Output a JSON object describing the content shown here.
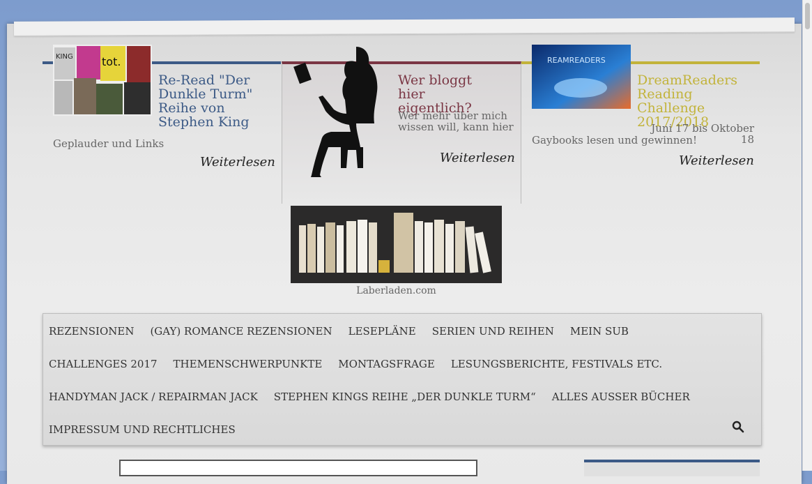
{
  "features": [
    {
      "title": "Re-Read \"Der Dunkle Turm\" Reihe von Stephen King",
      "desc": "Geplauder und Links",
      "more": "Weiterlesen",
      "color": "#3c5a86"
    },
    {
      "title": "Wer bloggt hier eigentlich?",
      "desc": "Wer mehr über mich wissen will, kann hier",
      "more": "Weiterlesen",
      "color": "#7a3644"
    },
    {
      "title": "DreamReaders Reading Challenge 2017/2018",
      "date": "Juni 17 bis Oktober 18",
      "desc": "Gaybooks lesen und gewinnen!",
      "more": "Weiterlesen",
      "color": "#c2b33a",
      "badge": "REAMREADERS"
    }
  ],
  "site": {
    "caption": "Laberladen.com"
  },
  "nav": {
    "row1": [
      "REZENSIONEN",
      "(GAY) ROMANCE REZENSIONEN",
      "LESEPLÄNE",
      "SERIEN UND REIHEN",
      "MEIN SUB"
    ],
    "row2": [
      "CHALLENGES 2017",
      "THEMENSCHWERPUNKTE",
      "MONTAGSFRAGE",
      "LESUNGSBERICHTE, FESTIVALS ETC."
    ],
    "row3": [
      "HANDYMAN JACK / REPAIRMAN JACK",
      "STEPHEN KINGS REIHE „DER DUNKLE TURM“",
      "ALLES AUSSER BÜCHER"
    ],
    "row4": [
      "IMPRESSUM UND RECHTLICHES"
    ]
  }
}
